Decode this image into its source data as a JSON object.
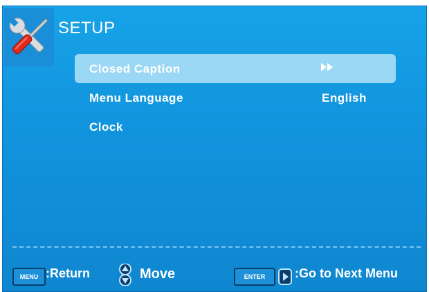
{
  "header": {
    "title": "SETUP",
    "icon": "tools-icon"
  },
  "menu": {
    "items": [
      {
        "label": "Closed Caption",
        "value": "",
        "selected": true,
        "value_icon": "double-arrow-right-icon"
      },
      {
        "label": "Menu Language",
        "value": "English",
        "selected": false
      },
      {
        "label": "Clock",
        "value": "",
        "selected": false
      }
    ]
  },
  "footer": {
    "menu_key": "MENU",
    "return_label": ":Return",
    "move_label": "Move",
    "enter_key": "ENTER",
    "next_label": ":Go to Next Menu"
  },
  "colors": {
    "background": "#1295de",
    "highlight": "#9ad8f6",
    "text": "#ffffff"
  }
}
